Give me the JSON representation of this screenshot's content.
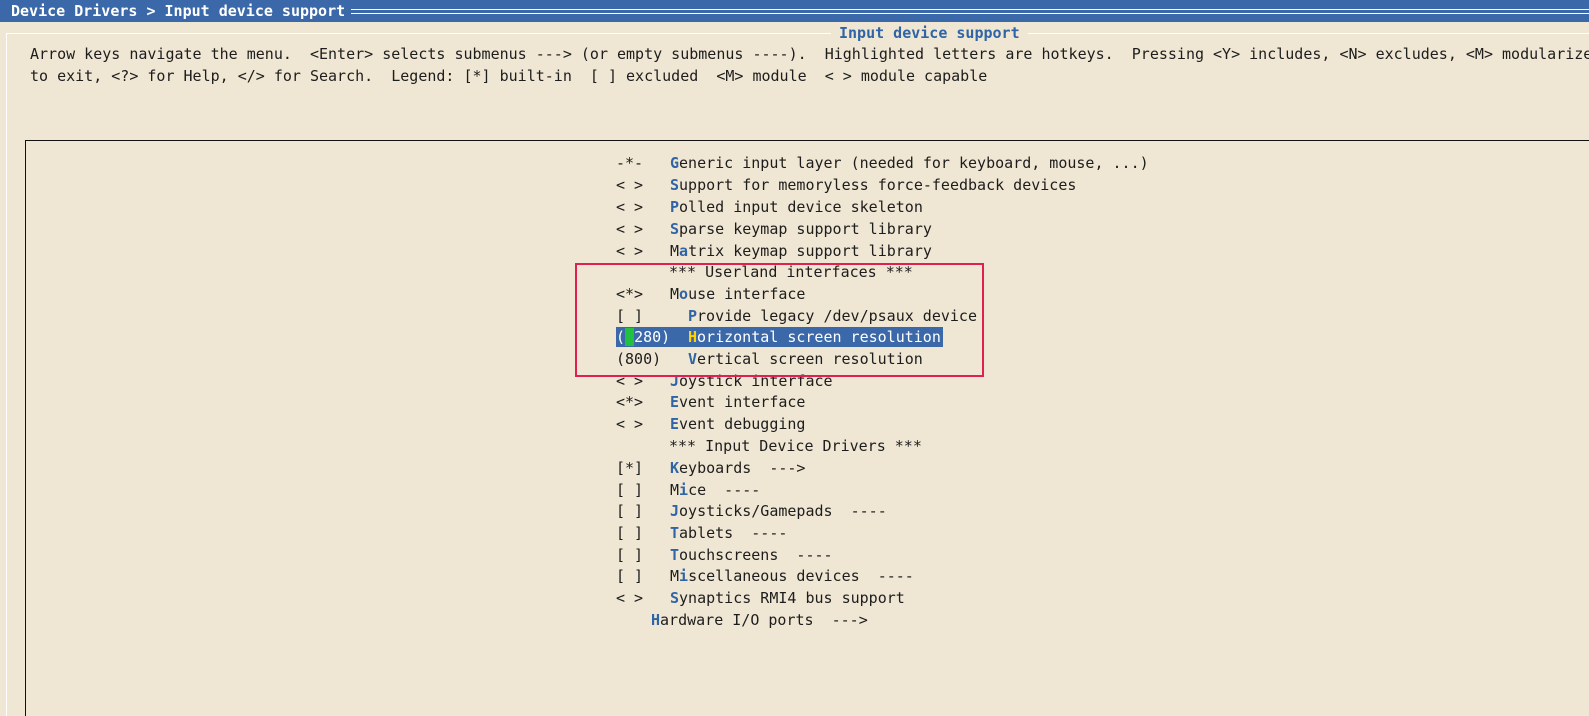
{
  "breadcrumb": "Device Drivers > Input device support",
  "dialog": {
    "title": "Input device support"
  },
  "help": {
    "line1": "Arrow keys navigate the menu.  <Enter> selects submenus ---> (or empty submenus ----).  Highlighted letters are hotkeys.  Pressing <Y> includes, <N> excludes, <M> modularize",
    "line2": "to exit, <?> for Help, </> for Search.  Legend: [*] built-in  [ ] excluded  <M> module  < > module capable"
  },
  "menu": {
    "items": [
      {
        "state": "-*-",
        "hot": "G",
        "rest": "eneric input layer (needed for keyboard, mouse, ...)"
      },
      {
        "state": "< >",
        "hot": "S",
        "rest": "upport for memoryless force-feedback devices"
      },
      {
        "state": "< >",
        "hot": "P",
        "rest": "olled input device skeleton"
      },
      {
        "state": "< >",
        "hot": "S",
        "rest": "parse keymap support library"
      },
      {
        "state": "< >",
        "pre": "M",
        "hot": "a",
        "rest": "trix keymap support library"
      },
      {
        "state": "",
        "label": "*** Userland interfaces ***"
      },
      {
        "state": "<*>",
        "pre": "M",
        "hot": "o",
        "rest": "use interface"
      },
      {
        "state": "[ ]",
        "hot": "P",
        "rest": "rovide legacy /dev/psaux device"
      },
      {
        "state_cursor": "1",
        "state_rest": "280)",
        "hot": "H",
        "rest": "orizontal screen resolution"
      },
      {
        "state": "(800)",
        "hot": "V",
        "rest": "ertical screen resolution"
      },
      {
        "state": "< >",
        "hot": "J",
        "rest": "oystick interface"
      },
      {
        "state": "<*>",
        "hot": "E",
        "rest": "vent interface"
      },
      {
        "state": "< >",
        "hot": "E",
        "rest": "vent debugging"
      },
      {
        "state": "",
        "label": "*** Input Device Drivers ***"
      },
      {
        "state": "[*]",
        "hot": "K",
        "rest": "eyboards  --->"
      },
      {
        "state": "[ ]",
        "pre": "M",
        "hot": "i",
        "rest": "ce  ----"
      },
      {
        "state": "[ ]",
        "hot": "J",
        "rest": "oysticks/Gamepads  ----"
      },
      {
        "state": "[ ]",
        "hot": "T",
        "rest": "ablets  ----"
      },
      {
        "state": "[ ]",
        "hot": "T",
        "rest": "ouchscreens  ----"
      },
      {
        "state": "[ ]",
        "pre": "M",
        "hot": "i",
        "rest": "scellaneous devices  ----"
      },
      {
        "state": "< >",
        "hot": "S",
        "rest": "ynaptics RMI4 bus support"
      },
      {
        "hot": "H",
        "rest": "ardware I/O ports  --->"
      }
    ]
  }
}
